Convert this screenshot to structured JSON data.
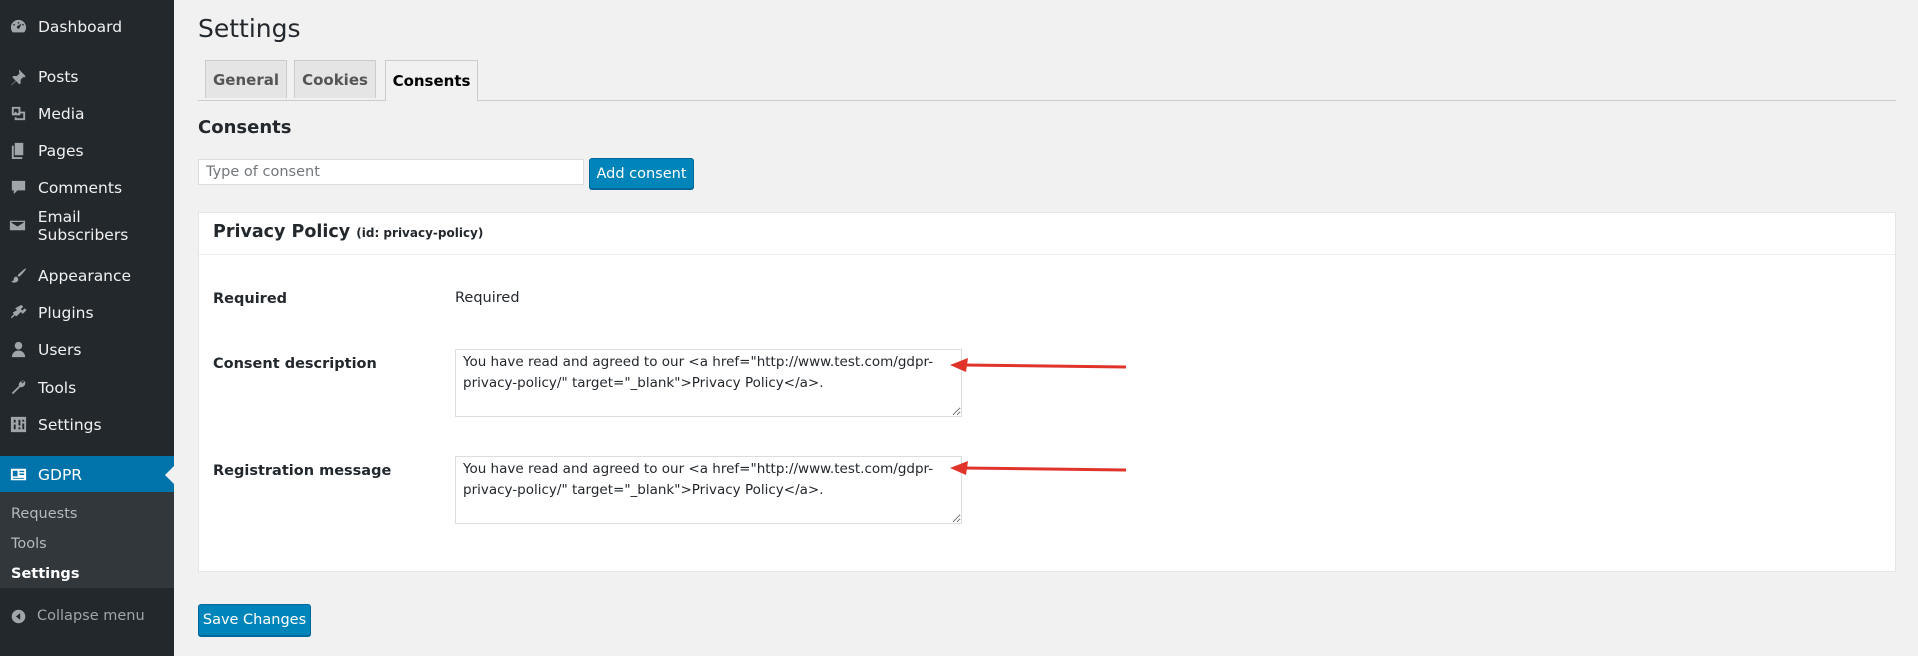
{
  "sidebar": {
    "items": [
      {
        "label": "Dashboard",
        "icon": "dashboard-icon"
      },
      {
        "label": "Posts",
        "icon": "pin-icon"
      },
      {
        "label": "Media",
        "icon": "media-icon"
      },
      {
        "label": "Pages",
        "icon": "pages-icon"
      },
      {
        "label": "Comments",
        "icon": "comment-icon"
      },
      {
        "label": "Email Subscribers",
        "icon": "email-icon"
      },
      {
        "label": "Appearance",
        "icon": "brush-icon"
      },
      {
        "label": "Plugins",
        "icon": "plugin-icon"
      },
      {
        "label": "Users",
        "icon": "user-icon"
      },
      {
        "label": "Tools",
        "icon": "wrench-icon"
      },
      {
        "label": "Settings",
        "icon": "settings-icon"
      },
      {
        "label": "GDPR",
        "icon": "id-card-icon",
        "current": true
      }
    ],
    "submenu": [
      "Requests",
      "Tools",
      "Settings"
    ],
    "submenu_active": "Settings",
    "collapse_label": "Collapse menu"
  },
  "page": {
    "title": "Settings",
    "tabs": [
      "General",
      "Cookies",
      "Consents"
    ],
    "active_tab": "Consents",
    "section_title": "Consents",
    "consent_input_placeholder": "Type of consent",
    "add_consent_label": "Add consent",
    "save_label": "Save Changes"
  },
  "consent": {
    "title": "Privacy Policy",
    "id_label": "(id: privacy-policy)",
    "required_label": "Required",
    "required_value": "Required",
    "description_label": "Consent description",
    "description_value": "You have read and agreed to our <a href=\"http://www.test.com/gdpr-privacy-policy/\" target=\"_blank\">Privacy Policy</a>.",
    "registration_label": "Registration message",
    "registration_value": "You have read and agreed to our <a href=\"http://www.test.com/gdpr-privacy-policy/\" target=\"_blank\">Privacy Policy</a>."
  },
  "colors": {
    "sidebar_bg": "#23282d",
    "accent": "#0073aa",
    "button": "#0085ba",
    "annotation_arrow": "#e0342b"
  }
}
